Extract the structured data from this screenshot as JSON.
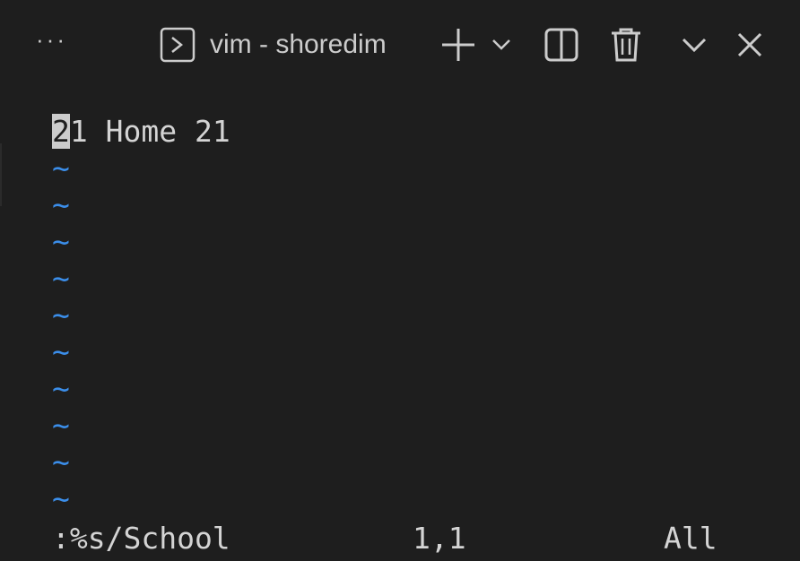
{
  "toolbar": {
    "more_label": "···",
    "terminal_title": "vim - shoredim"
  },
  "editor": {
    "first_line_cursor_char": "2",
    "first_line_rest": "1 Home 21",
    "tilde_char": "~",
    "tilde_count": 10
  },
  "status": {
    "command": ":%s/School",
    "position": "1,1",
    "scroll": "All"
  },
  "colors": {
    "background": "#1e1e1e",
    "text": "#d4d4d4",
    "tilde": "#3b8eea",
    "icon": "#cccccc"
  }
}
